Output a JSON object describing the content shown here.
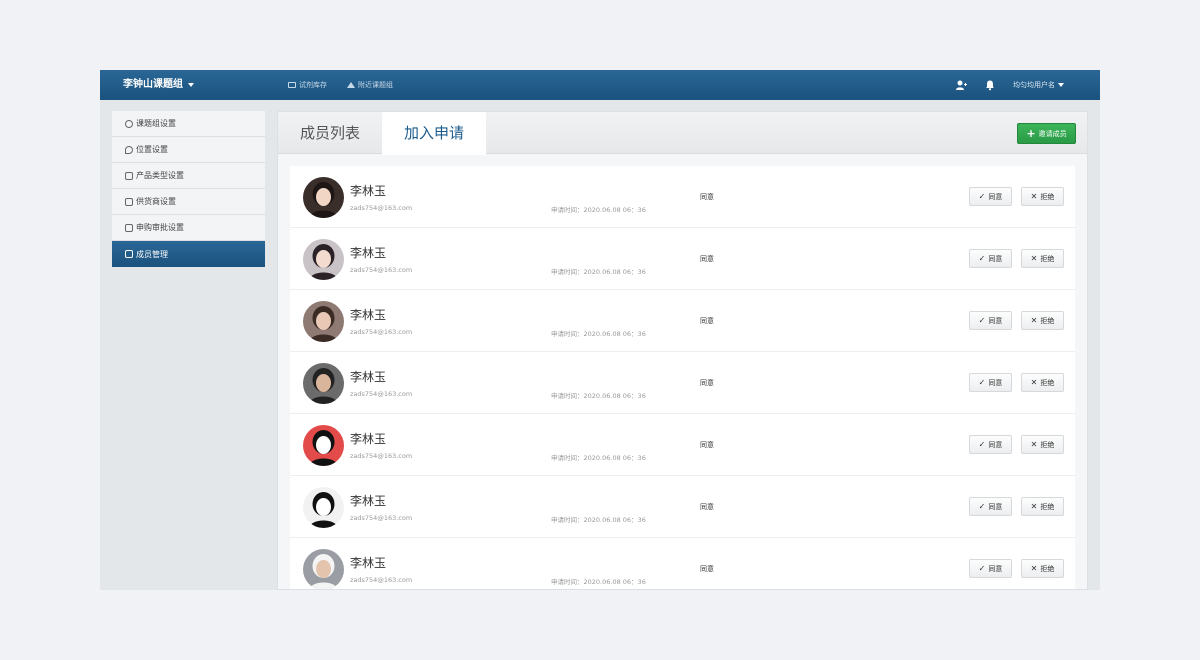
{
  "topbar": {
    "brand": "李钟山课题组",
    "links": [
      {
        "label": "试剂库存",
        "icon": "archive-icon"
      },
      {
        "label": "附近课题组",
        "icon": "location-icon"
      }
    ],
    "username": "均匀均用户名"
  },
  "sidebar": {
    "items": [
      {
        "label": "课题组设置",
        "icon": "settings-icon",
        "active": false
      },
      {
        "label": "位置设置",
        "icon": "location-pin-icon",
        "active": false
      },
      {
        "label": "产品类型设置",
        "icon": "grid-icon",
        "active": false
      },
      {
        "label": "供货商设置",
        "icon": "truck-icon",
        "active": false
      },
      {
        "label": "申购审批设置",
        "icon": "cart-icon",
        "active": false
      },
      {
        "label": "成员管理",
        "icon": "members-icon",
        "active": true
      }
    ]
  },
  "tabs": [
    {
      "label": "成员列表",
      "active": false
    },
    {
      "label": "加入申请",
      "active": true
    }
  ],
  "invite_button": "邀请成员",
  "labels": {
    "agree": "同意",
    "reject": "拒绝"
  },
  "applicants": [
    {
      "name": "李林玉",
      "email": "zads754@163.com",
      "apply_time": "申请时间：2020.06.08  06：36",
      "status": "同意",
      "avatar_bg": "#3a2e2a"
    },
    {
      "name": "李林玉",
      "email": "zads754@163.com",
      "apply_time": "申请时间：2020.06.08  06：36",
      "status": "同意",
      "avatar_bg": "#c9c3c8"
    },
    {
      "name": "李林玉",
      "email": "zads754@163.com",
      "apply_time": "申请时间：2020.06.08  06：36",
      "status": "同意",
      "avatar_bg": "#8e7a72"
    },
    {
      "name": "李林玉",
      "email": "zads754@163.com",
      "apply_time": "申请时间：2020.06.08  06：36",
      "status": "同意",
      "avatar_bg": "#6b6b6b"
    },
    {
      "name": "李林玉",
      "email": "zads754@163.com",
      "apply_time": "申请时间：2020.06.08  06：36",
      "status": "同意",
      "avatar_bg": "#e34b4b"
    },
    {
      "name": "李林玉",
      "email": "zads754@163.com",
      "apply_time": "申请时间：2020.06.08  06：36",
      "status": "同意",
      "avatar_bg": "#f2f2f2"
    },
    {
      "name": "李林玉",
      "email": "zads754@163.com",
      "apply_time": "申请时间：2020.06.08  06：36",
      "status": "同意",
      "avatar_bg": "#9a9da3"
    }
  ],
  "colors": {
    "topbar": "#1f5a88",
    "active_tab_text": "#1b5b8c",
    "invite_green": "#2fa64d"
  }
}
